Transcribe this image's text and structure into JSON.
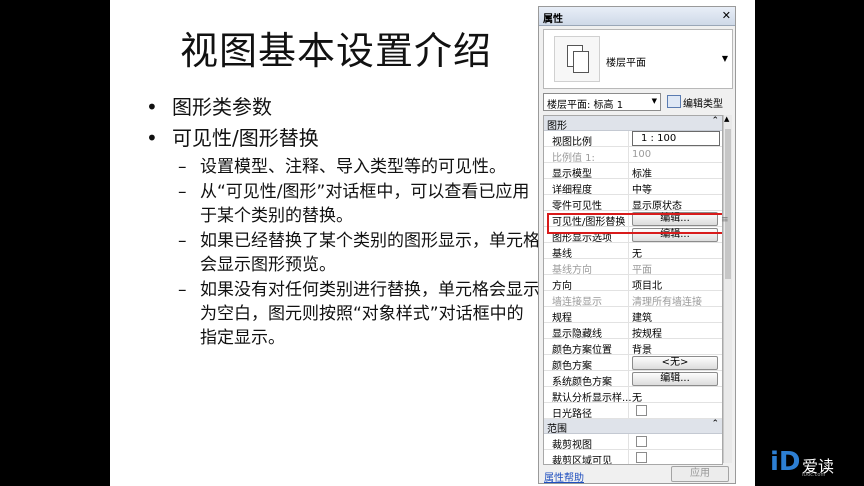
{
  "slide": {
    "title": "视图基本设置介绍",
    "bullets": [
      {
        "text": "图形类参数"
      },
      {
        "text": "可见性/图形替换"
      }
    ],
    "sub_bullets": [
      {
        "text": "设置模型、注释、导入类型等的可见性。"
      },
      {
        "text": "从“可见性/图形”对话框中，可以查看已应用于某个类别的替换。"
      },
      {
        "text": "如果已经替换了某个类别的图形显示，单元格会显示图形预览。"
      },
      {
        "text": "如果没有对任何类别进行替换，单元格会显示为空白，图元则按照“对象样式”对话框中的指定显示。"
      }
    ]
  },
  "properties_panel": {
    "title": "属性",
    "close_glyph": "✕",
    "type_name": "楼层平面",
    "instance_selector": "楼层平面: 标高 1",
    "edit_type_label": "编辑类型",
    "group_graphics": "图形",
    "group_extents": "范围",
    "collapse_glyph": "⌃",
    "rows": [
      {
        "key": "视图比例",
        "value": "1 : 100"
      },
      {
        "key": "比例值 1:",
        "value": "100"
      },
      {
        "key": "显示模型",
        "value": "标准"
      },
      {
        "key": "详细程度",
        "value": "中等"
      },
      {
        "key": "零件可见性",
        "value": "显示原状态"
      },
      {
        "key": "可见性/图形替换",
        "value": "编辑..."
      },
      {
        "key": "图形显示选项",
        "value": "编辑..."
      },
      {
        "key": "基线",
        "value": "无"
      },
      {
        "key": "基线方向",
        "value": "平面"
      },
      {
        "key": "方向",
        "value": "项目北"
      },
      {
        "key": "墙连接显示",
        "value": "清理所有墙连接"
      },
      {
        "key": "规程",
        "value": "建筑"
      },
      {
        "key": "显示隐藏线",
        "value": "按规程"
      },
      {
        "key": "颜色方案位置",
        "value": "背景"
      },
      {
        "key": "颜色方案",
        "value": "<无>"
      },
      {
        "key": "系统颜色方案",
        "value": "编辑..."
      },
      {
        "key": "默认分析显示样...",
        "value": "无"
      },
      {
        "key": "日光路径",
        "value": ""
      }
    ],
    "extents_rows": [
      {
        "key": "裁剪视图",
        "value": ""
      },
      {
        "key": "裁剪区域可见",
        "value": ""
      }
    ],
    "help_link": "属性帮助",
    "apply_button": "应用"
  },
  "branding": {
    "logo_mark": "iD",
    "name": "爱读",
    "sub": "iDoc.com"
  },
  "colors": {
    "highlight": "#d81b1b",
    "link": "#1f4fbf",
    "logo": "#2d7fd3"
  }
}
